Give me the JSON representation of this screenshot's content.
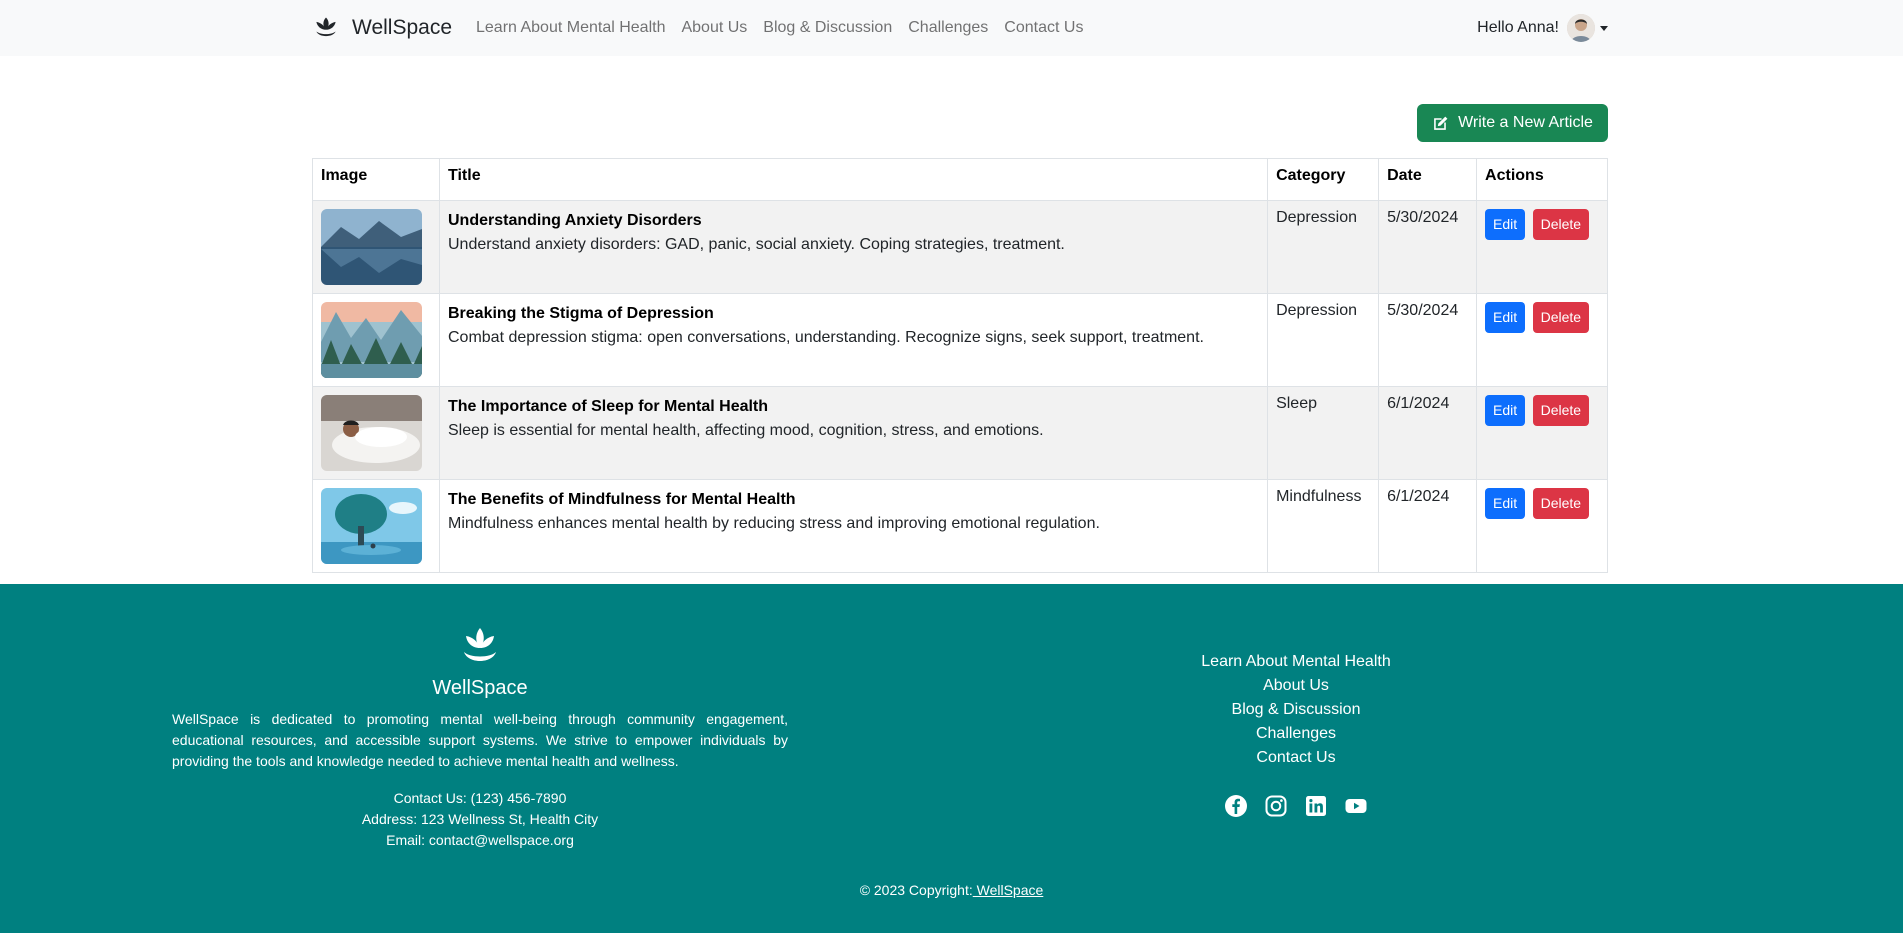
{
  "nav": {
    "brand": "WellSpace",
    "links": [
      "Learn About Mental Health",
      "About Us",
      "Blog & Discussion",
      "Challenges",
      "Contact Us"
    ],
    "greeting": "Hello Anna!"
  },
  "actions": {
    "write_label": "Write a New Article"
  },
  "table": {
    "headers": [
      "Image",
      "Title",
      "Category",
      "Date",
      "Actions"
    ],
    "rows": [
      {
        "title": "Understanding Anxiety Disorders",
        "desc": "Understand anxiety disorders: GAD, panic, social anxiety. Coping strategies, treatment.",
        "category": "Depression",
        "date": "5/30/2024"
      },
      {
        "title": "Breaking the Stigma of Depression",
        "desc": "Combat depression stigma: open conversations, understanding. Recognize signs, seek support, treatment.",
        "category": "Depression",
        "date": "5/30/2024"
      },
      {
        "title": "The Importance of Sleep for Mental Health",
        "desc": "Sleep is essential for mental health, affecting mood, cognition, stress, and emotions.",
        "category": "Sleep",
        "date": "6/1/2024"
      },
      {
        "title": "The Benefits of Mindfulness for Mental Health",
        "desc": "Mindfulness enhances mental health by reducing stress and improving emotional regulation.",
        "category": "Mindfulness",
        "date": "6/1/2024"
      }
    ],
    "edit_label": "Edit",
    "delete_label": "Delete"
  },
  "footer": {
    "brand": "WellSpace",
    "description": "WellSpace is dedicated to promoting mental well-being through community engagement, educational resources, and accessible support systems. We strive to empower individuals by providing the tools and knowledge needed to achieve mental health and wellness.",
    "contact": "Contact Us: (123) 456-7890",
    "address": "Address: 123 Wellness St, Health City",
    "email": "Email: contact@wellspace.org",
    "links": [
      "Learn About Mental Health",
      "About Us",
      "Blog & Discussion",
      "Challenges",
      "Contact Us"
    ],
    "copyright_prefix": "© 2023 Copyright:",
    "copyright_link": " WellSpace"
  },
  "colors": {
    "primary_green": "#198754",
    "footer_teal": "#008080",
    "edit_blue": "#0d6efd",
    "delete_red": "#dc3545"
  },
  "icons": [
    "lotus-logo-icon",
    "edit-icon",
    "facebook-icon",
    "instagram-icon",
    "linkedin-icon",
    "youtube-icon"
  ]
}
